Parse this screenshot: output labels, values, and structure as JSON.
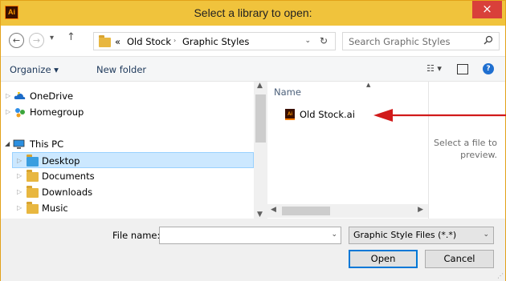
{
  "window": {
    "title": "Select a library to open:",
    "app_icon_text": "Ai",
    "close_glyph": "×"
  },
  "nav": {
    "back_glyph": "←",
    "forward_glyph": "→",
    "recent_glyph": "▾",
    "up_glyph": "↑",
    "address": {
      "overflow": "«",
      "crumbs": [
        "Old Stock",
        "Graphic Styles"
      ],
      "separator": "›",
      "dropdown_glyph": "⌄",
      "refresh_glyph": "↻"
    },
    "search": {
      "placeholder": "Search Graphic Styles",
      "icon": "search-icon"
    }
  },
  "toolbar": {
    "organize_label": "Organize ▾",
    "new_folder_label": "New folder",
    "view_icon": "view-options-icon",
    "view_glyph": "☷ ▾",
    "pane_icon": "preview-pane-icon",
    "help_icon": "help-icon",
    "help_glyph": "?"
  },
  "tree": {
    "items": [
      {
        "label": "OneDrive",
        "icon": "onedrive-icon",
        "expand": "▷"
      },
      {
        "label": "Homegroup",
        "icon": "homegroup-icon",
        "expand": "▷"
      },
      {
        "label": "This PC",
        "icon": "this-pc-icon",
        "expand": "◢"
      },
      {
        "label": "Desktop",
        "icon": "folder-icon",
        "expand": "▷",
        "selected": true
      },
      {
        "label": "Documents",
        "icon": "folder-icon",
        "expand": "▷"
      },
      {
        "label": "Downloads",
        "icon": "folder-icon",
        "expand": "▷"
      },
      {
        "label": "Music",
        "icon": "folder-icon",
        "expand": "▷"
      }
    ]
  },
  "file_list": {
    "column_header": "Name",
    "files": [
      {
        "name": "Old Stock.ai",
        "icon": "ai-file-icon"
      }
    ]
  },
  "preview": {
    "line1": "Select a file to",
    "line2": "preview."
  },
  "bottom": {
    "file_name_label": "File name:",
    "file_name_value": "",
    "file_type_selected": "Graphic Style Files (*.*)",
    "open_label": "Open",
    "cancel_label": "Cancel"
  },
  "colors": {
    "titlebar": "#f0c33c",
    "close_button": "#d9403a",
    "annotation_arrow": "#d11a1a",
    "selection": "#cce8ff"
  }
}
